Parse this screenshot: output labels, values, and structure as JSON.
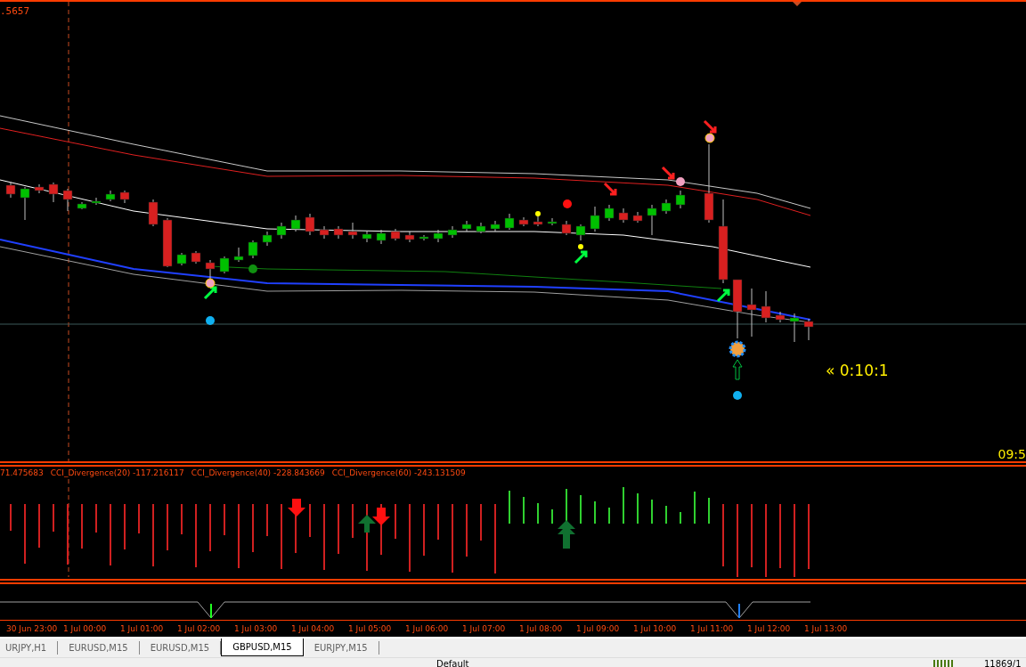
{
  "price_label": ".5657",
  "timer": "« 0:10:1",
  "clock": "09:5",
  "indicator_legend": [
    {
      "text": "71.475683"
    },
    {
      "text": "CCI_Divergence(20) -117.216117"
    },
    {
      "text": "CCI_Divergence(40) -228.843669"
    },
    {
      "text": "CCI_Divergence(60) -243.131509"
    }
  ],
  "time_axis": [
    "30 Jun 23:00",
    "1 Jul 00:00",
    "1 Jul 01:00",
    "1 Jul 02:00",
    "1 Jul 03:00",
    "1 Jul 04:00",
    "1 Jul 05:00",
    "1 Jul 06:00",
    "1 Jul 07:00",
    "1 Jul 08:00",
    "1 Jul 09:00",
    "1 Jul 10:00",
    "1 Jul 11:00",
    "1 Jul 12:00",
    "1 Jul 13:00"
  ],
  "tabs": [
    {
      "label": "URJPY,H1",
      "selected": false
    },
    {
      "label": "EURUSD,M15",
      "selected": false
    },
    {
      "label": "EURUSD,M15",
      "selected": false
    },
    {
      "label": "GBPUSD,M15",
      "selected": true
    },
    {
      "label": "EURJPY,M15",
      "selected": false
    }
  ],
  "status_bar": {
    "profile": "Default",
    "traffic": "11869/1"
  }
}
